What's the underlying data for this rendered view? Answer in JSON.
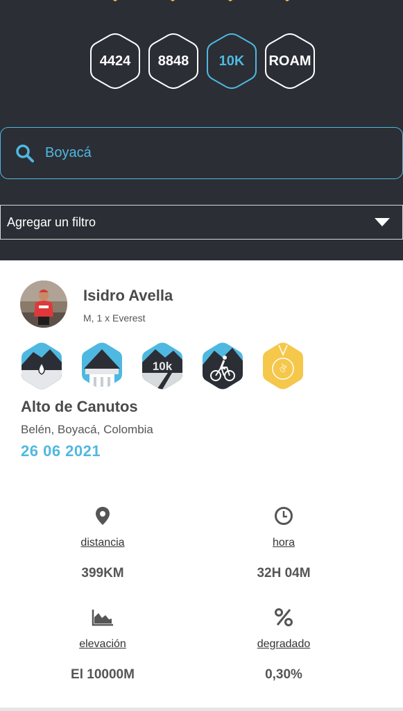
{
  "colors": {
    "dark_bg": "#2b2e35",
    "accent": "#4fb8e0",
    "gold": "#f5c74a"
  },
  "hex_filters": [
    {
      "label": "4424",
      "active": false
    },
    {
      "label": "8848",
      "active": false
    },
    {
      "label": "10K",
      "active": true
    },
    {
      "label": "ROAM",
      "active": false
    }
  ],
  "search": {
    "value": "Boyacá",
    "icon": "search-icon"
  },
  "filter": {
    "label": "Agregar un filtro",
    "icon": "caret-down-icon"
  },
  "user": {
    "name": "Isidro Avella",
    "meta": "M, 1 x Everest"
  },
  "badges": [
    "drop-mountain-badge",
    "tower-mountain-badge",
    "10k-mountain-badge",
    "cyclist-badge",
    "gold-medal-badge"
  ],
  "badge_text": {
    "tenk": "10k",
    "medal": "ঔ"
  },
  "route": {
    "title": "Alto de Canutos",
    "location": "Belén, Boyacá, Colombia",
    "date": "26 06 2021"
  },
  "stats": {
    "distance": {
      "label": "distancia",
      "value": "399KM",
      "icon": "location-pin-icon"
    },
    "time": {
      "label": "hora",
      "value": "32H 04M",
      "icon": "clock-icon"
    },
    "elevation": {
      "label": "elevación",
      "value": "El 10000M",
      "icon": "elevation-chart-icon"
    },
    "gradient": {
      "label": "degradado",
      "value": "0,30%",
      "icon": "percent-icon"
    }
  }
}
